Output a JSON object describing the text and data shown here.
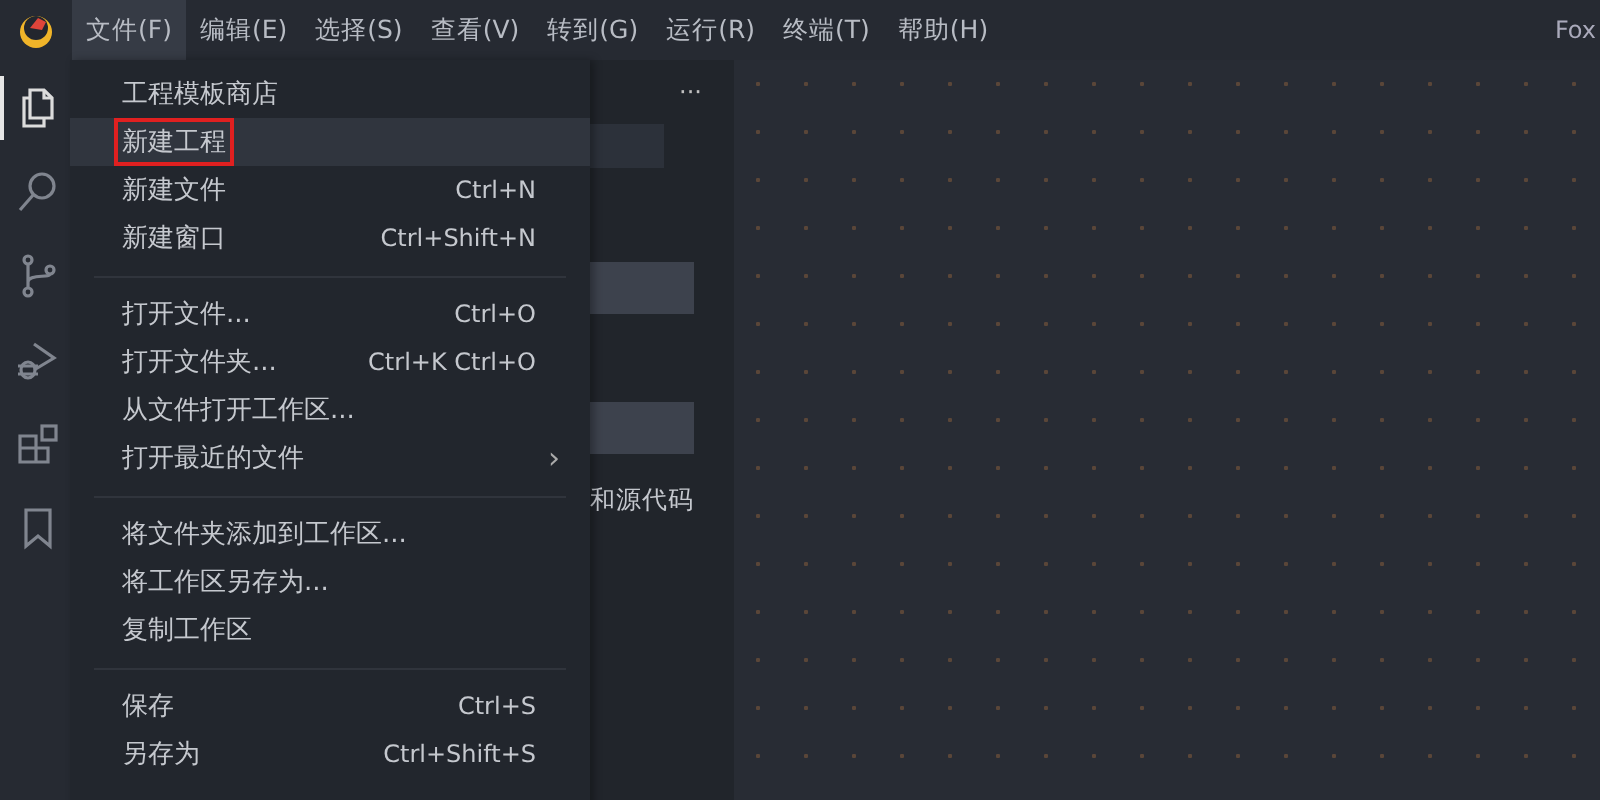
{
  "menubar": {
    "app_name": "Fox",
    "menus": [
      {
        "label": "文件(F)",
        "selected": true
      },
      {
        "label": "编辑(E)",
        "selected": false
      },
      {
        "label": "选择(S)",
        "selected": false
      },
      {
        "label": "查看(V)",
        "selected": false
      },
      {
        "label": "转到(G)",
        "selected": false
      },
      {
        "label": "运行(R)",
        "selected": false
      },
      {
        "label": "终端(T)",
        "selected": false
      },
      {
        "label": "帮助(H)",
        "selected": false
      }
    ]
  },
  "activity_bar": {
    "items": [
      {
        "kind": "files",
        "selected": true
      },
      {
        "kind": "search",
        "selected": false
      },
      {
        "kind": "source-control",
        "selected": false
      },
      {
        "kind": "debug",
        "selected": false
      },
      {
        "kind": "extensions",
        "selected": false
      },
      {
        "kind": "bookmark",
        "selected": false
      }
    ]
  },
  "side_panel": {
    "more": "···",
    "partial_text": "和源代码"
  },
  "file_menu": {
    "groups": [
      [
        {
          "label": "工程模板商店",
          "selected": false,
          "outlined": false
        },
        {
          "label": "新建工程",
          "selected": true,
          "outlined": true
        },
        {
          "label": "新建文件",
          "shortcut": "Ctrl+N",
          "selected": false,
          "outlined": false
        },
        {
          "label": "新建窗口",
          "shortcut": "Ctrl+Shift+N",
          "selected": false,
          "outlined": false
        }
      ],
      [
        {
          "label": "打开文件...",
          "shortcut": "Ctrl+O",
          "selected": false,
          "outlined": false
        },
        {
          "label": "打开文件夹...",
          "shortcut": "Ctrl+K Ctrl+O",
          "selected": false,
          "outlined": false
        },
        {
          "label": "从文件打开工作区...",
          "selected": false,
          "outlined": false
        },
        {
          "label": "打开最近的文件",
          "submenu": "›",
          "selected": false,
          "outlined": false
        }
      ],
      [
        {
          "label": "将文件夹添加到工作区...",
          "selected": false,
          "outlined": false
        },
        {
          "label": "将工作区另存为...",
          "selected": false,
          "outlined": false
        },
        {
          "label": "复制工作区",
          "selected": false,
          "outlined": false
        }
      ],
      [
        {
          "label": "保存",
          "shortcut": "Ctrl+S",
          "selected": false,
          "outlined": false
        },
        {
          "label": "另存为",
          "shortcut": "Ctrl+Shift+S",
          "selected": false,
          "outlined": false
        }
      ]
    ]
  }
}
